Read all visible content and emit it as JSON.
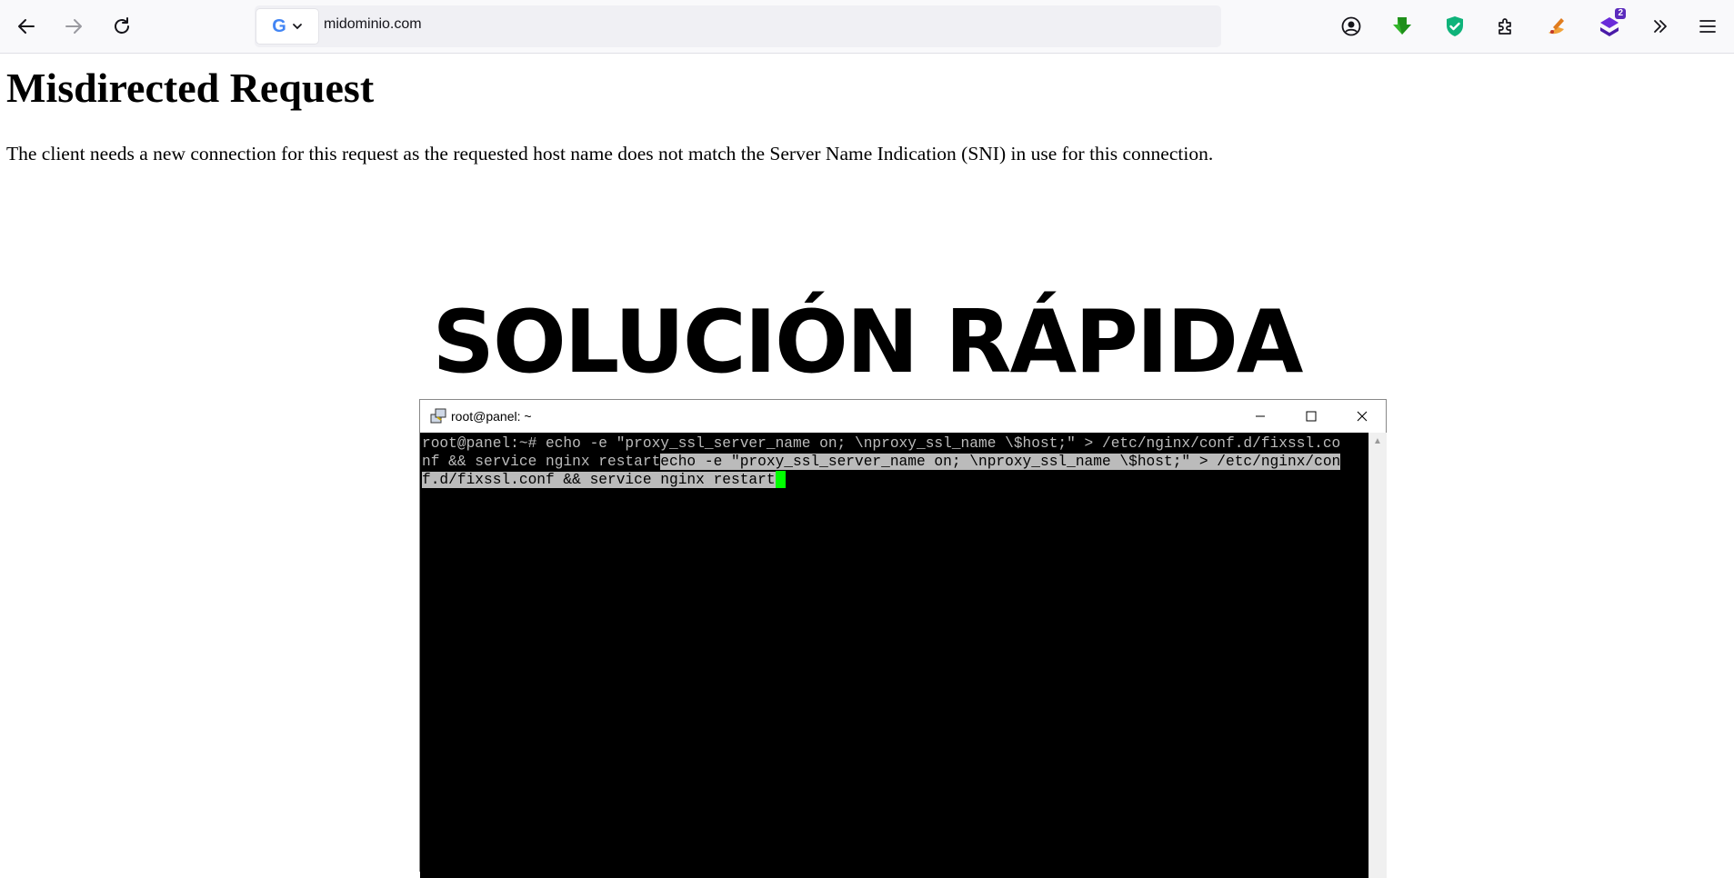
{
  "browser": {
    "url": "midominio.com",
    "extension_badge_count": "2"
  },
  "page": {
    "heading": "Misdirected Request",
    "message": "The client needs a new connection for this request as the requested host name does not match the Server Name Indication (SNI) in use for this connection."
  },
  "overlay": {
    "title": "SOLUCIÓN RÁPIDA"
  },
  "terminal": {
    "window_title": "root@panel: ~",
    "line1": "root@panel:~# echo -e \"proxy_ssl_server_name on; \\nproxy_ssl_name \\$host;\" > /etc/nginx/conf.d/fixssl.co",
    "line2_plain": "nf && service nginx restart",
    "line2_selected": "echo -e \"proxy_ssl_server_name on; \\nproxy_ssl_name \\$host;\" > /etc/nginx/con",
    "line3_selected": "f.d/fixssl.conf && service nginx restart"
  },
  "colors": {
    "terminal_bg": "#000000",
    "terminal_fg": "#bbbbbb",
    "cursor": "#00ff00",
    "selection": "#bbbbbb"
  }
}
